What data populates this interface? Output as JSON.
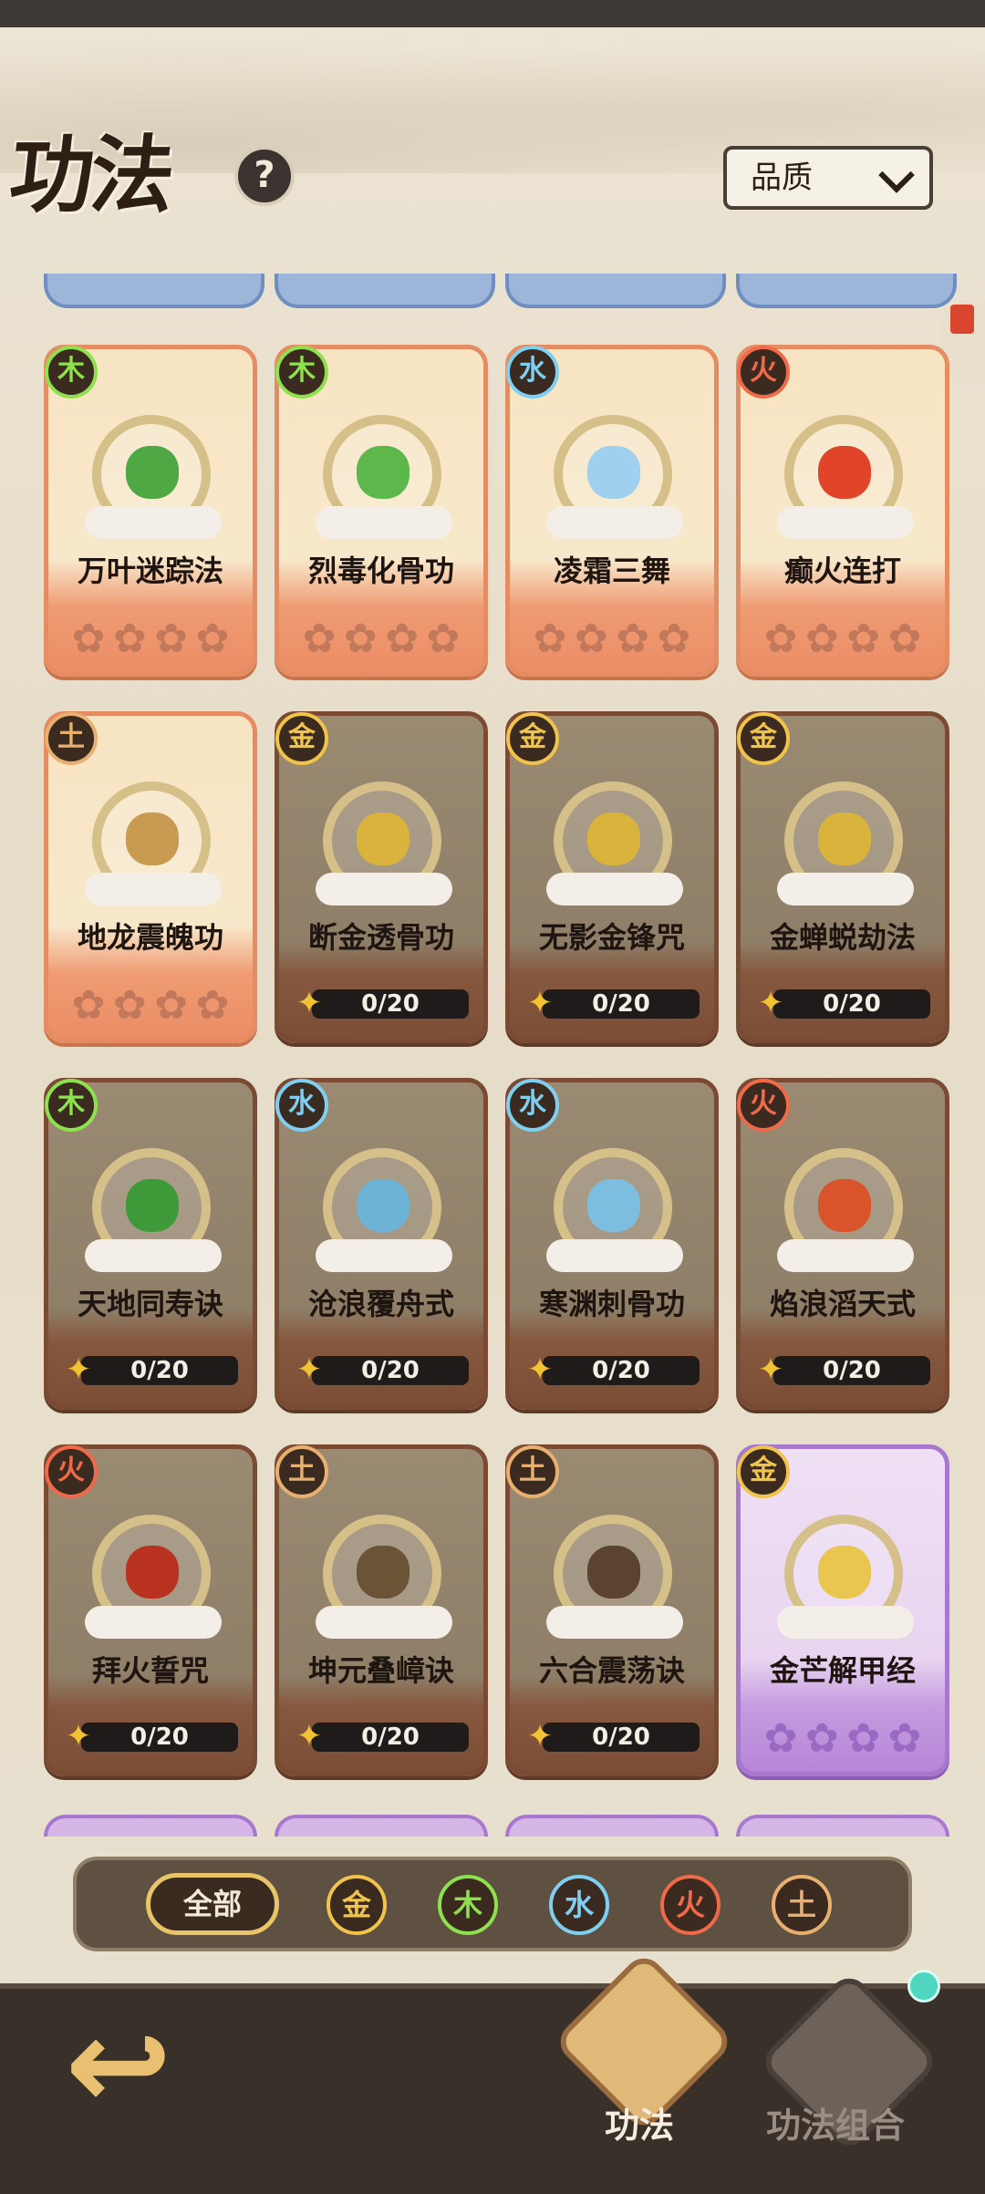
{
  "header": {
    "title": "功法",
    "help": "?",
    "sort_label": "品质"
  },
  "cards": [
    {
      "element": "木",
      "name": "万叶迷踪法",
      "style": "orange",
      "progress": null,
      "core": "#4ea843"
    },
    {
      "element": "木",
      "name": "烈毒化骨功",
      "style": "orange",
      "progress": null,
      "core": "#5cb84a"
    },
    {
      "element": "水",
      "name": "凌霜三舞",
      "style": "orange",
      "progress": null,
      "core": "#9fd1ee"
    },
    {
      "element": "火",
      "name": "癫火连打",
      "style": "orange",
      "progress": null,
      "core": "#e0452a"
    },
    {
      "element": "土",
      "name": "地龙震魄功",
      "style": "orange",
      "progress": null,
      "core": "#c99a52"
    },
    {
      "element": "金",
      "name": "断金透骨功",
      "style": "brown",
      "progress": "0/20",
      "core": "#d9b33c"
    },
    {
      "element": "金",
      "name": "无影金锋咒",
      "style": "brown",
      "progress": "0/20",
      "core": "#d9b33c"
    },
    {
      "element": "金",
      "name": "金蝉蜕劫法",
      "style": "brown",
      "progress": "0/20",
      "core": "#d9b33c"
    },
    {
      "element": "木",
      "name": "天地同寿诀",
      "style": "brown",
      "progress": "0/20",
      "core": "#3f9a3a"
    },
    {
      "element": "水",
      "name": "沧浪覆舟式",
      "style": "brown",
      "progress": "0/20",
      "core": "#6db3d6"
    },
    {
      "element": "水",
      "name": "寒渊刺骨功",
      "style": "brown",
      "progress": "0/20",
      "core": "#7dbde0"
    },
    {
      "element": "火",
      "name": "焰浪滔天式",
      "style": "brown",
      "progress": "0/20",
      "core": "#d9532b"
    },
    {
      "element": "火",
      "name": "拜火誓咒",
      "style": "brown",
      "progress": "0/20",
      "core": "#b8321f"
    },
    {
      "element": "土",
      "name": "坤元叠嶂诀",
      "style": "brown",
      "progress": "0/20",
      "core": "#6b5336"
    },
    {
      "element": "土",
      "name": "六合震荡诀",
      "style": "brown",
      "progress": "0/20",
      "core": "#5a4430"
    },
    {
      "element": "金",
      "name": "金芒解甲经",
      "style": "purple",
      "progress": null,
      "core": "#e8c650"
    }
  ],
  "filters": {
    "all": "全部",
    "elements": [
      "金",
      "木",
      "水",
      "火",
      "土"
    ]
  },
  "element_colors": {
    "金": "#f0c44a",
    "木": "#8fe04f",
    "水": "#7fd0f0",
    "火": "#f06a4a",
    "土": "#e8b070"
  },
  "nav": {
    "tab_active": "功法",
    "tab_other": "功法组合",
    "back_icon": "back-arrow-icon"
  }
}
